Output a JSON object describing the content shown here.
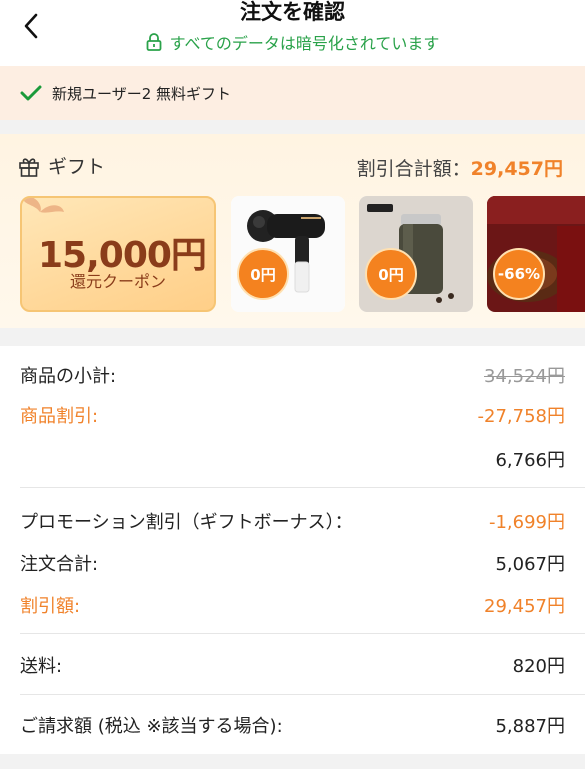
{
  "header": {
    "title": "注文を確認",
    "secure_text": "すべてのデータは暗号化されています"
  },
  "new_user": {
    "text": "新規ユーザー2 無料ギフト"
  },
  "gift": {
    "label": "ギフト",
    "total_label": "割引合計額：",
    "total_amount": "29,457円",
    "coupon_value": "15,000円",
    "coupon_label": "還元クーポン",
    "products": [
      {
        "badge": "0円",
        "name": "massage-gun"
      },
      {
        "badge": "0円",
        "name": "tumbler"
      },
      {
        "badge": "-66%",
        "name": "beef-hayashi"
      }
    ]
  },
  "summary": {
    "subtotal_label": "商品の小計:",
    "subtotal_value": "34,524円",
    "item_discount_label": "商品割引:",
    "item_discount_value": "-27,758円",
    "after_discount_value": "6,766円",
    "promo_label": "プロモーション割引（ギフトボーナス）：",
    "promo_value": "-1,699円",
    "order_total_label": "注文合計:",
    "order_total_value": "5,067円",
    "discount_total_label": "割引額:",
    "discount_total_value": "29,457円",
    "shipping_label": "送料:",
    "shipping_value": "820円",
    "billing_label": "ご請求額 (税込 ※該当する場合):",
    "billing_value": "5,887円"
  },
  "colors": {
    "accent": "#f0822a",
    "secure_green": "#2aa24a",
    "check_green": "#1a9a3a"
  }
}
